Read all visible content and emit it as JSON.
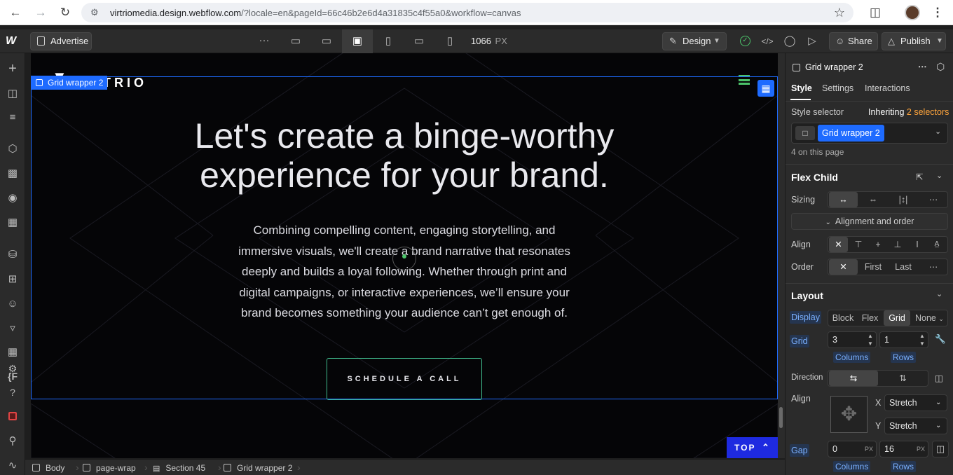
{
  "browser": {
    "url_domain": "virtriomedia.design.webflow.com",
    "url_rest": "/?locale=en&pageId=66c46b2e6d4a31835c4f55a0&workflow=canvas"
  },
  "topbar": {
    "logo": "W",
    "page_name": "Advertise",
    "more": "···",
    "canvas_width": "1066",
    "canvas_unit": "PX",
    "mode_label": "Design",
    "share_label": "Share",
    "publish_label": "Publish"
  },
  "canvas": {
    "selection_label": "Grid wrapper 2",
    "brand_text": "TRIO",
    "headline_line1": "Let's create a binge-worthy",
    "headline_line2": "experience for your brand.",
    "paragraph_lines": [
      "Combining compelling content, engaging storytelling, and",
      "immersive visuals, we'll create a brand narrative that resonates",
      "deeply and builds a loyal following. Whether through print and",
      "digital campaigns, or interactive experiences, we’ll ensure your",
      "brand becomes something your audience can’t get enough of."
    ],
    "cta_label": "SCHEDULE A CALL",
    "top_button_label": "TOP",
    "accent_color": "#1e6bff"
  },
  "panel": {
    "element_name": "Grid wrapper 2",
    "tabs": [
      "Style",
      "Settings",
      "Interactions"
    ],
    "style_selector_label": "Style selector",
    "inheriting_label": "Inheriting",
    "inheriting_count": "2 selectors",
    "selector_chip": "Grid wrapper 2",
    "on_page": "4 on this page",
    "flex_child_title": "Flex Child",
    "sizing_label": "Sizing",
    "alignment_order_label": "Alignment and order",
    "align_label": "Align",
    "order_label": "Order",
    "order_options": [
      "First",
      "Last"
    ],
    "layout_title": "Layout",
    "display_label": "Display",
    "display_options": [
      "Block",
      "Flex",
      "Grid",
      "None"
    ],
    "display_selected": "Grid",
    "grid_label": "Grid",
    "grid_columns": "3",
    "grid_rows": "1",
    "columns_label": "Columns",
    "rows_label": "Rows",
    "direction_label": "Direction",
    "align2_label": "Align",
    "x_label": "X",
    "x_value": "Stretch",
    "y_label": "Y",
    "y_value": "Stretch",
    "gap_label": "Gap",
    "gap_columns": "0",
    "gap_rows": "16",
    "gap_unit": "PX",
    "gap_columns_label": "Columns",
    "gap_rows_label": "Rows",
    "highlight_color": "#7ab0ff",
    "inherit_color": "#ffa53c"
  },
  "breadcrumbs": [
    "Body",
    "page-wrap",
    "Section 45",
    "Grid wrapper 2"
  ]
}
